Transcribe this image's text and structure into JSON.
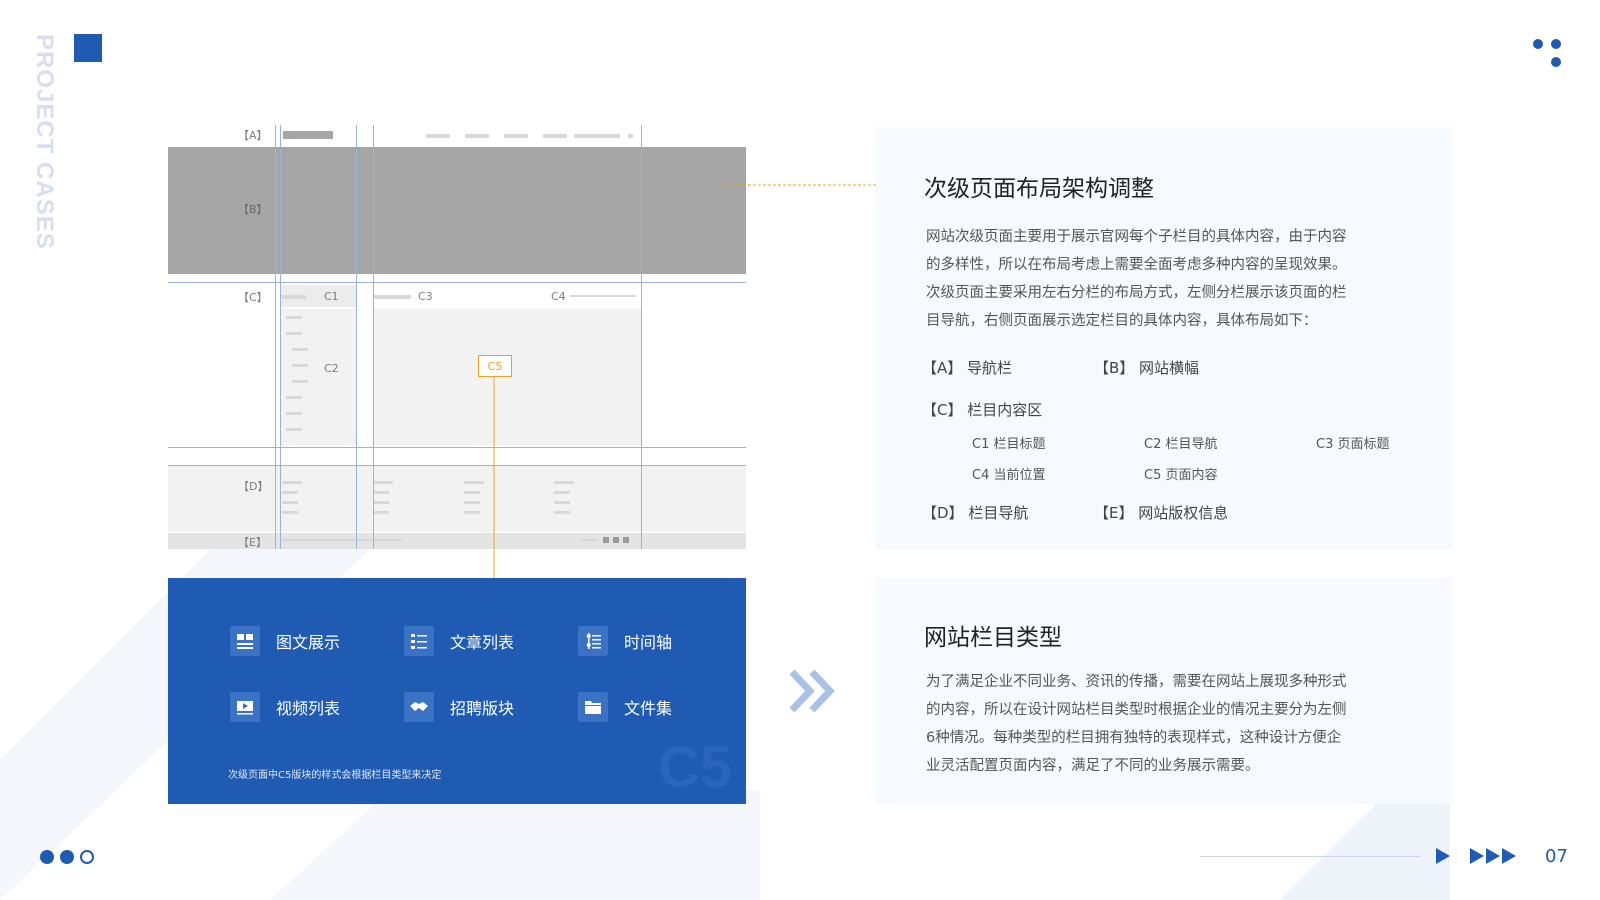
{
  "side_label": "PROJECT CASES",
  "wireframe": {
    "labels": {
      "a": "【A】",
      "b": "【B】",
      "c": "【C】",
      "d": "【D】",
      "e": "【E】"
    },
    "c1": "C1",
    "c2": "C2",
    "c3": "C3",
    "c4": "C4",
    "c5": "C5"
  },
  "panel": {
    "items": [
      {
        "label": "图文展示",
        "icon": "grid-layout-icon"
      },
      {
        "label": "文章列表",
        "icon": "list-icon"
      },
      {
        "label": "时间轴",
        "icon": "timeline-icon"
      },
      {
        "label": "视频列表",
        "icon": "video-icon"
      },
      {
        "label": "招聘版块",
        "icon": "handshake-icon"
      },
      {
        "label": "文件集",
        "icon": "folder-icon"
      }
    ],
    "note": "次级页面中C5版块的样式会根据栏目类型来决定",
    "watermark": "C5"
  },
  "card1": {
    "title": "次级页面布局架构调整",
    "para": [
      "网站次级页面主要用于展示官网每个子栏目的具体内容，由于内容",
      "的多样性，所以在布局考虑上需要全面考虑多种内容的呈现效果。",
      "次级页面主要采用左右分栏的布局方式，左侧分栏展示该页面的栏",
      "目导航，右侧页面展示选定栏目的具体内容，具体布局如下："
    ],
    "legend": {
      "a": "【A】 导航栏",
      "b": "【B】 网站横幅",
      "c": "【C】 栏目内容区",
      "c1": "C1 栏目标题",
      "c2": "C2 栏目导航",
      "c3": "C3 页面标题",
      "c4": "C4 当前位置",
      "c5": "C5 页面内容",
      "d": "【D】 栏目导航",
      "e": "【E】 网站版权信息"
    }
  },
  "card2": {
    "title": "网站栏目类型",
    "para": [
      "为了满足企业不同业务、资讯的传播，需要在网站上展现多种形式",
      "的内容，所以在设计网站栏目类型时根据企业的情况主要分为左侧",
      "6种情况。每种类型的栏目拥有独特的表现样式，这种设计方便企",
      "业灵活配置页面内容，满足了不同的业务展示需要。"
    ]
  },
  "page_number": "07",
  "colors": {
    "primary": "#1f5bb3",
    "accent": "#f0a020",
    "card_bg": "#f6f9fd"
  }
}
